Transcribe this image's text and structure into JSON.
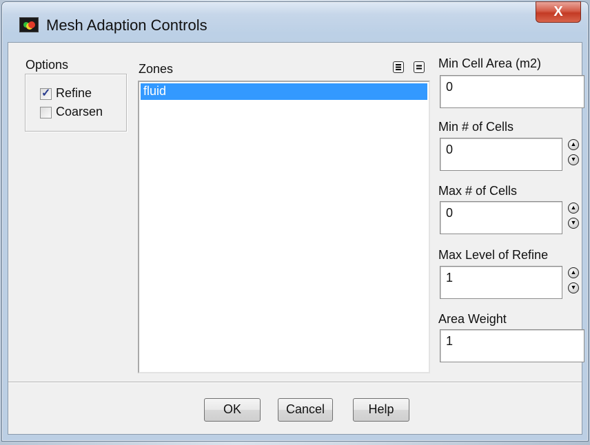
{
  "window": {
    "title": "Mesh Adaption Controls",
    "close_label": "X"
  },
  "options": {
    "label": "Options",
    "refine": {
      "label": "Refine",
      "checked": true
    },
    "coarsen": {
      "label": "Coarsen",
      "checked": false
    }
  },
  "zones": {
    "label": "Zones",
    "items": [
      "fluid"
    ],
    "selected": "fluid"
  },
  "fields": {
    "min_cell_area": {
      "label": "Min Cell Area (m2)",
      "value": "0"
    },
    "min_cells": {
      "label": "Min # of Cells",
      "value": "0"
    },
    "max_cells": {
      "label": "Max # of Cells",
      "value": "0"
    },
    "max_level": {
      "label": "Max Level of Refine",
      "value": "1"
    },
    "area_weight": {
      "label": "Area Weight",
      "value": "1"
    }
  },
  "buttons": {
    "ok": "OK",
    "cancel": "Cancel",
    "help": "Help"
  },
  "colors": {
    "selection": "#3399ff",
    "close": "#c94a35",
    "dialog_bg": "#f0f0f0"
  }
}
